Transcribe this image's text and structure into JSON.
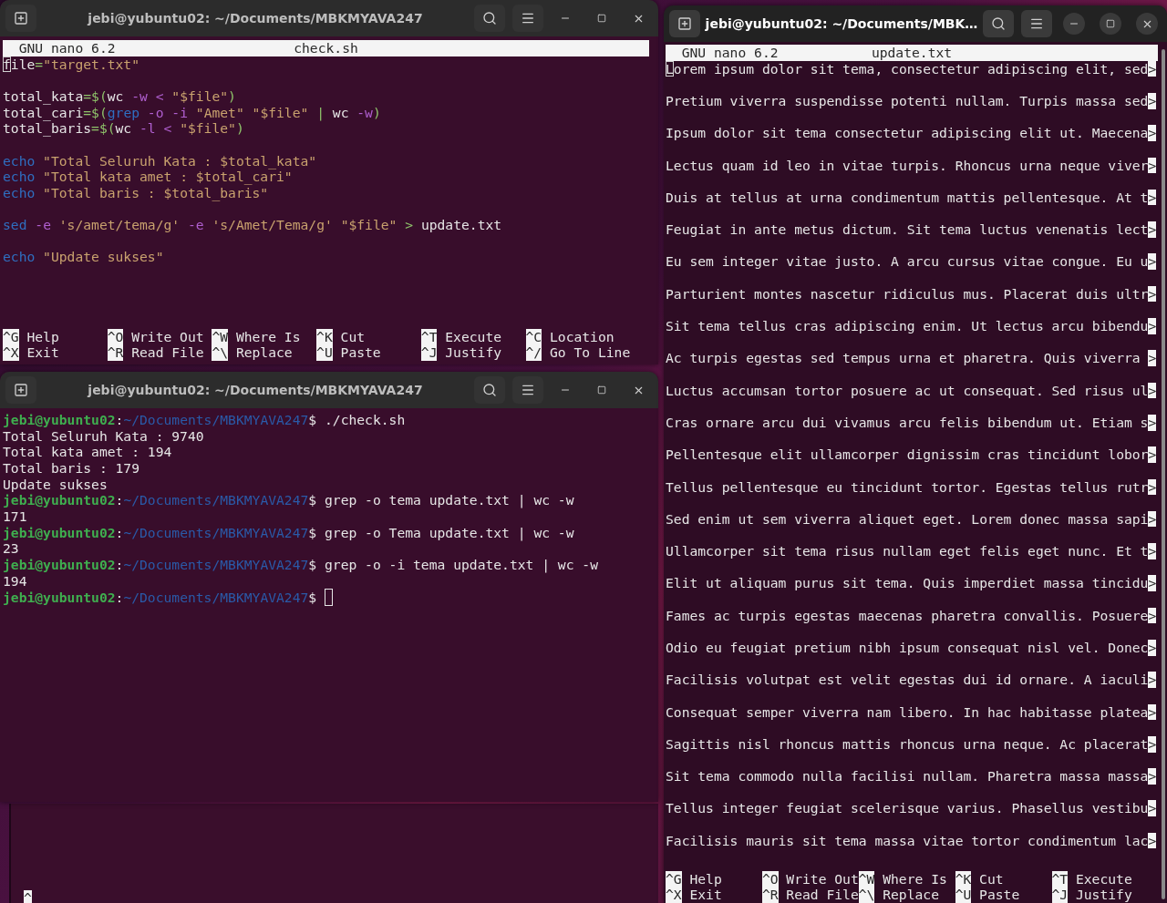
{
  "windows": [
    {
      "kind": "editor",
      "active": false,
      "title": "jebi@yubuntu02: ~/Documents/MBKMYAVA247",
      "app": "GNU nano 6.2",
      "file": "check.sh",
      "blocks": [
        [
          [
            {
              "kind": "text",
              "t": "file"
            },
            {
              "kind": "op",
              "t": "="
            },
            {
              "kind": "str",
              "t": "\"target.txt\""
            }
          ]
        ],
        [
          [
            {
              "kind": "text",
              "t": "total_kata"
            },
            {
              "kind": "op",
              "t": "=$("
            },
            {
              "kind": "text",
              "t": "wc "
            },
            {
              "kind": "flag",
              "t": "-w <"
            },
            {
              "kind": "str",
              "t": " \"$file\""
            },
            {
              "kind": "op",
              "t": ")"
            }
          ],
          [
            {
              "kind": "text",
              "t": "total_cari"
            },
            {
              "kind": "op",
              "t": "=$("
            },
            {
              "kind": "cmd",
              "t": "grep"
            },
            {
              "kind": "flag",
              "t": " -o -i"
            },
            {
              "kind": "str",
              "t": " \"Amet\" \"$file\""
            },
            {
              "kind": "op",
              "t": " |"
            },
            {
              "kind": "text",
              "t": " wc "
            },
            {
              "kind": "flag",
              "t": "-w"
            },
            {
              "kind": "op",
              "t": ")"
            }
          ],
          [
            {
              "kind": "text",
              "t": "total_baris"
            },
            {
              "kind": "op",
              "t": "=$("
            },
            {
              "kind": "text",
              "t": "wc "
            },
            {
              "kind": "flag",
              "t": "-l <"
            },
            {
              "kind": "str",
              "t": " \"$file\""
            },
            {
              "kind": "op",
              "t": ")"
            }
          ]
        ],
        [
          [
            {
              "kind": "cmd",
              "t": "echo"
            },
            {
              "kind": "str",
              "t": " \"Total Seluruh Kata : $total_kata\""
            }
          ],
          [
            {
              "kind": "cmd",
              "t": "echo"
            },
            {
              "kind": "str",
              "t": " \"Total kata amet : $total_cari\""
            }
          ],
          [
            {
              "kind": "cmd",
              "t": "echo"
            },
            {
              "kind": "str",
              "t": " \"Total baris : $total_baris\""
            }
          ]
        ],
        [
          [
            {
              "kind": "cmd",
              "t": "sed"
            },
            {
              "kind": "flag",
              "t": " -e"
            },
            {
              "kind": "str",
              "t": " 's/amet/tema/g'"
            },
            {
              "kind": "flag",
              "t": " -e"
            },
            {
              "kind": "str",
              "t": " 's/Amet/Tema/g' \"$file\""
            },
            {
              "kind": "op",
              "t": " >"
            },
            {
              "kind": "text",
              "t": " update.txt"
            }
          ]
        ],
        [
          [
            {
              "kind": "cmd",
              "t": "echo"
            },
            {
              "kind": "str",
              "t": " \"Update sukses\""
            }
          ]
        ]
      ],
      "shortcuts": [
        [
          {
            "key": "^G",
            "label": "Help"
          },
          {
            "key": "^X",
            "label": "Exit"
          }
        ],
        [
          {
            "key": "^O",
            "label": "Write Out"
          },
          {
            "key": "^R",
            "label": "Read File"
          }
        ],
        [
          {
            "key": "^W",
            "label": "Where Is"
          },
          {
            "key": "^\\",
            "label": "Replace"
          }
        ],
        [
          {
            "key": "^K",
            "label": "Cut"
          },
          {
            "key": "^U",
            "label": "Paste"
          }
        ],
        [
          {
            "key": "^T",
            "label": "Execute"
          },
          {
            "key": "^J",
            "label": "Justify"
          }
        ],
        [
          {
            "key": "^C",
            "label": "Location"
          },
          {
            "key": "^/",
            "label": "Go To Line"
          }
        ]
      ]
    },
    {
      "kind": "shell",
      "active": false,
      "title": "jebi@yubuntu02: ~/Documents/MBKMYAVA247",
      "lines": [
        {
          "kind": "prompt",
          "user": "jebi@yubuntu02",
          "sep": ":",
          "path": "~/Documents/MBKMYAVA247",
          "sign": "$",
          "command": "./check.sh",
          "cursor": false
        },
        {
          "kind": "output",
          "text": "Total Seluruh Kata : 9740"
        },
        {
          "kind": "output",
          "text": "Total kata amet : 194"
        },
        {
          "kind": "output",
          "text": "Total baris : 179"
        },
        {
          "kind": "output",
          "text": "Update sukses"
        },
        {
          "kind": "prompt",
          "user": "jebi@yubuntu02",
          "sep": ":",
          "path": "~/Documents/MBKMYAVA247",
          "sign": "$",
          "command": "grep -o tema update.txt | wc -w",
          "cursor": false
        },
        {
          "kind": "output",
          "text": "171"
        },
        {
          "kind": "prompt",
          "user": "jebi@yubuntu02",
          "sep": ":",
          "path": "~/Documents/MBKMYAVA247",
          "sign": "$",
          "command": "grep -o Tema update.txt | wc -w",
          "cursor": false
        },
        {
          "kind": "output",
          "text": "23"
        },
        {
          "kind": "prompt",
          "user": "jebi@yubuntu02",
          "sep": ":",
          "path": "~/Documents/MBKMYAVA247",
          "sign": "$",
          "command": "grep -o -i tema update.txt | wc -w",
          "cursor": false
        },
        {
          "kind": "output",
          "text": "194"
        },
        {
          "kind": "prompt",
          "user": "jebi@yubuntu02",
          "sep": ":",
          "path": "~/Documents/MBKMYAVA247",
          "sign": "$",
          "cursor": true
        }
      ]
    },
    {
      "kind": "viewer",
      "active": true,
      "title": "jebi@yubuntu02: ~/Documents/MBK…",
      "app": "GNU nano 6.2",
      "file": "update.txt",
      "lines": [
        {
          "text": "Lorem ipsum dolor sit tema, consectetur adipiscing elit, sed",
          "mark": ">"
        },
        {
          "text": "Pretium viverra suspendisse potenti nullam. Turpis massa sed",
          "mark": ">"
        },
        {
          "text": "Ipsum dolor sit tema consectetur adipiscing elit ut. Maecena",
          "mark": ">"
        },
        {
          "text": "Lectus quam id leo in vitae turpis. Rhoncus urna neque viver",
          "mark": ">"
        },
        {
          "text": "Duis at tellus at urna condimentum mattis pellentesque. At t",
          "mark": ">"
        },
        {
          "text": "Feugiat in ante metus dictum. Sit tema luctus venenatis lect",
          "mark": ">"
        },
        {
          "text": "Eu sem integer vitae justo. A arcu cursus vitae congue. Eu u",
          "mark": ">"
        },
        {
          "text": "Parturient montes nascetur ridiculus mus. Placerat duis ultr",
          "mark": ">"
        },
        {
          "text": "Sit tema tellus cras adipiscing enim. Ut lectus arcu bibendu",
          "mark": ">"
        },
        {
          "text": "Ac turpis egestas sed tempus urna et pharetra. Quis viverra ",
          "mark": ">"
        },
        {
          "text": "Luctus accumsan tortor posuere ac ut consequat. Sed risus ul",
          "mark": ">"
        },
        {
          "text": "Cras ornare arcu dui vivamus arcu felis bibendum ut. Etiam s",
          "mark": ">"
        },
        {
          "text": "Pellentesque elit ullamcorper dignissim cras tincidunt lobor",
          "mark": ">"
        },
        {
          "text": "Tellus pellentesque eu tincidunt tortor. Egestas tellus rutr",
          "mark": ">"
        },
        {
          "text": "Sed enim ut sem viverra aliquet eget. Lorem donec massa sapi",
          "mark": ">"
        },
        {
          "text": "Ullamcorper sit tema risus nullam eget felis eget nunc. Et t",
          "mark": ">"
        },
        {
          "text": "Elit ut aliquam purus sit tema. Quis imperdiet massa tincidu",
          "mark": ">"
        },
        {
          "text": "Fames ac turpis egestas maecenas pharetra convallis. Posuere",
          "mark": ">"
        },
        {
          "text": "Odio eu feugiat pretium nibh ipsum consequat nisl vel. Donec",
          "mark": ">"
        },
        {
          "text": "Facilisis volutpat est velit egestas dui id ornare. A iaculi",
          "mark": ">"
        },
        {
          "text": "Consequat semper viverra nam libero. In hac habitasse platea",
          "mark": ">"
        },
        {
          "text": "Sagittis nisl rhoncus mattis rhoncus urna neque. Ac placerat",
          "mark": ">"
        },
        {
          "text": "Sit tema commodo nulla facilisi nullam. Pharetra massa massa",
          "mark": ">"
        },
        {
          "text": "Tellus integer feugiat scelerisque varius. Phasellus vestibu",
          "mark": ">"
        },
        {
          "text": "Facilisis mauris sit tema massa vitae tortor condimentum lac",
          "mark": ">"
        }
      ],
      "shortcuts": [
        [
          {
            "key": "^G",
            "label": "Help"
          },
          {
            "key": "^X",
            "label": "Exit"
          }
        ],
        [
          {
            "key": "^O",
            "label": "Write Out"
          },
          {
            "key": "^R",
            "label": "Read File"
          }
        ],
        [
          {
            "key": "^W",
            "label": "Where Is"
          },
          {
            "key": "^\\",
            "label": "Replace"
          }
        ],
        [
          {
            "key": "^K",
            "label": "Cut"
          },
          {
            "key": "^U",
            "label": "Paste"
          }
        ],
        [
          {
            "key": "^T",
            "label": "Execute"
          },
          {
            "key": "^J",
            "label": "Justify"
          }
        ]
      ]
    }
  ],
  "background_window": {
    "key": "^"
  }
}
